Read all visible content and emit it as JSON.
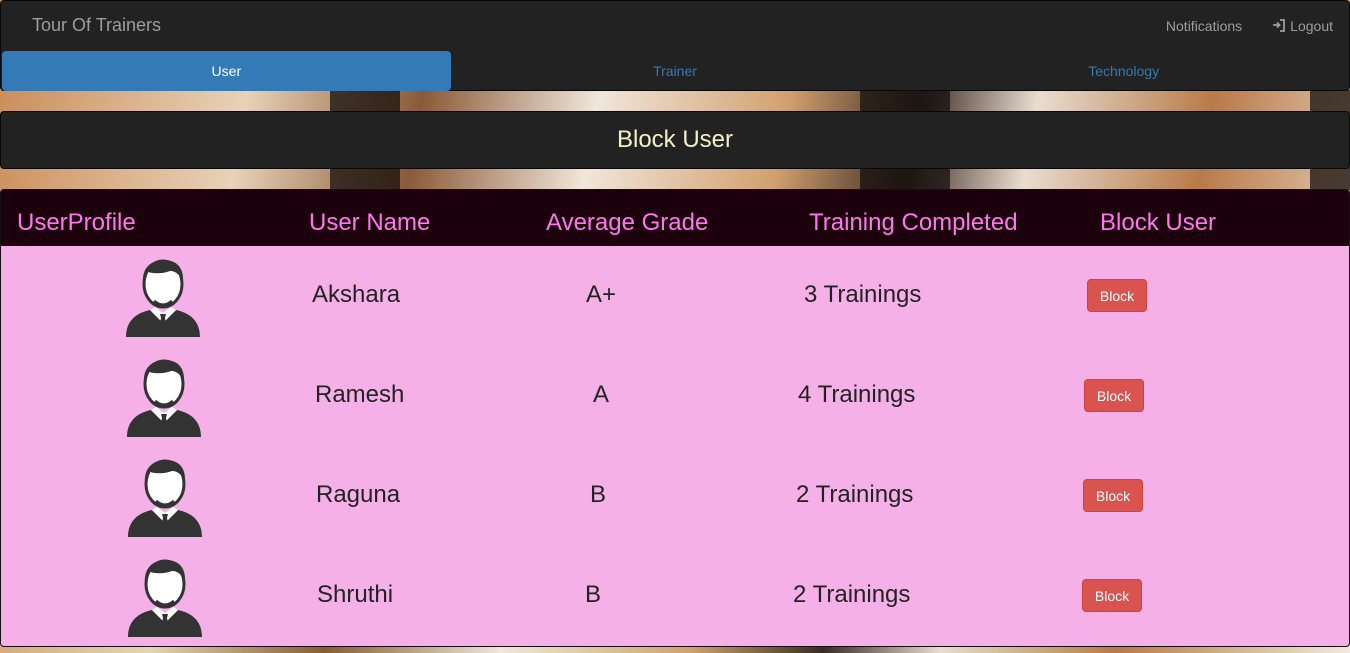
{
  "navbar": {
    "brand": "Tour Of Trainers",
    "notifications_label": "Notifications",
    "logout_label": "Logout",
    "logout_icon": "log-in-icon"
  },
  "tabs": [
    {
      "label": "User",
      "active": true
    },
    {
      "label": "Trainer",
      "active": false
    },
    {
      "label": "Technology",
      "active": false
    }
  ],
  "page_title": "Block User",
  "table": {
    "headers": [
      "UserProfile",
      "User Name",
      "Average Grade",
      "Training Completed",
      "Block User"
    ],
    "rows": [
      {
        "name": "Akshara",
        "grade": "A+",
        "trainings": "3 Trainings",
        "action": "Block",
        "avatar_icon": "user-avatar-icon"
      },
      {
        "name": "Ramesh",
        "grade": "A",
        "trainings": "4 Trainings",
        "action": "Block",
        "avatar_icon": "user-avatar-icon"
      },
      {
        "name": "Raguna",
        "grade": "B",
        "trainings": "2 Trainings",
        "action": "Block",
        "avatar_icon": "user-avatar-icon"
      },
      {
        "name": "Shruthi",
        "grade": "B",
        "trainings": "2 Trainings",
        "action": "Block",
        "avatar_icon": "user-avatar-icon"
      }
    ]
  },
  "colors": {
    "navbar_bg": "#222222",
    "active_tab": "#337ab7",
    "header_text": "#ff77ee",
    "table_bg": "#f5b0e8",
    "block_button": "#d9534f"
  }
}
